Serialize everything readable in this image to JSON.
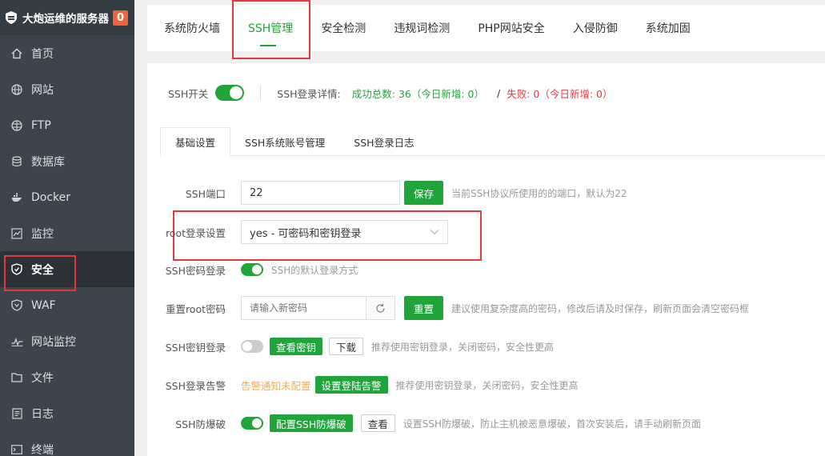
{
  "sidebar": {
    "brand": "大炮运维的服务器",
    "badge": "0",
    "items": [
      {
        "label": "首页",
        "icon": "home-icon"
      },
      {
        "label": "网站",
        "icon": "globe-icon"
      },
      {
        "label": "FTP",
        "icon": "ftp-globe-icon"
      },
      {
        "label": "数据库",
        "icon": "database-icon"
      },
      {
        "label": "Docker",
        "icon": "docker-icon"
      },
      {
        "label": "监控",
        "icon": "chart-icon"
      },
      {
        "label": "安全",
        "icon": "shield-icon"
      },
      {
        "label": "WAF",
        "icon": "waf-shield-icon"
      },
      {
        "label": "网站监控",
        "icon": "pulse-icon"
      },
      {
        "label": "文件",
        "icon": "folder-icon"
      },
      {
        "label": "日志",
        "icon": "log-icon"
      },
      {
        "label": "终端",
        "icon": "terminal-icon"
      }
    ]
  },
  "top_tabs": [
    "系统防火墙",
    "SSH管理",
    "安全检测",
    "违规词检测",
    "PHP网站安全",
    "入侵防御",
    "系统加固"
  ],
  "ssh_bar": {
    "switch_label": "SSH开关",
    "detail_label": "SSH登录详情:",
    "success": "成功总数: 36（今日新增: 0）",
    "separator": "/",
    "failed": "失败: 0（今日新增: 0）"
  },
  "sub_tabs": [
    "基础设置",
    "SSH系统账号管理",
    "SSH登录日志"
  ],
  "form": {
    "port": {
      "label": "SSH端口",
      "value": "22",
      "button": "保存",
      "hint": "当前SSH协议所使用的的端口，默认为22"
    },
    "root_login": {
      "label": "root登录设置",
      "value": "yes - 可密码和密钥登录"
    },
    "password_login": {
      "label": "SSH密码登录",
      "hint": "SSH的默认登录方式"
    },
    "reset_root": {
      "label": "重置root密码",
      "placeholder": "请输入新密码",
      "button": "重置",
      "hint": "建议使用复杂度高的密码，修改后请及时保存，刷新页面会清空密码框"
    },
    "key_login": {
      "label": "SSH密钥登录",
      "view_button": "查看密钥",
      "download_button": "下载",
      "hint": "推荐使用密钥登录，关闭密码，安全性更高"
    },
    "alert": {
      "label": "SSH登录告警",
      "status": "告警通知未配置",
      "button": "设置登陆告警",
      "hint": "推荐使用密钥登录，关闭密码，安全性更高"
    },
    "brute": {
      "label": "SSH防爆破",
      "config_button": "配置SSH防爆破",
      "view_button": "查看",
      "hint": "设置SSH防爆破，防止主机被恶意爆破，首次安装后，请手动刷新页面"
    }
  },
  "colors": {
    "accent": "#20a53a",
    "sidebar_bg": "#3c444d",
    "highlight": "#e4393c",
    "warning": "#f0ad4e"
  }
}
